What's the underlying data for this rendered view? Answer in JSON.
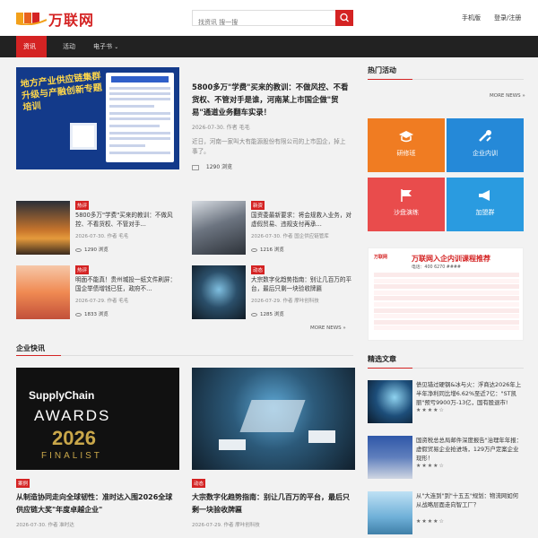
{
  "header": {
    "logo_text": "万联网",
    "search_placeholder": "找资讯 搜一搜",
    "mobile_label": "手机版",
    "login_label": "登录/注册"
  },
  "nav": [
    {
      "label": "资讯",
      "active": true,
      "has_menu": true
    },
    {
      "label": "活动",
      "active": false,
      "has_menu": false
    },
    {
      "label": "电子书",
      "active": false,
      "has_menu": true
    }
  ],
  "featured": {
    "banner_text": "地方产业供应链集群升级与产融创新专题培训",
    "title": "5800多万\"学费\"买来的教训：不做风控、不看货权、不管对手是谁，河南某上市国企做\"贸易\"通道业务翻车实录！",
    "meta": "2026-07-30. 作者 毛毛",
    "desc": "近日，河南一家叫大有能源股份有限公司的上市国企，掉上事了。",
    "views": "1290 浏览"
  },
  "cards": [
    {
      "tag": "热评",
      "title": "5800多万\"学费\"买来的教训：不做风控、不看货权、不管对手...",
      "meta": "2026-07-30. 作者 毛毛",
      "views": "1290 浏览"
    },
    {
      "tag": "新资",
      "title": "国资委最新要求：将会规救入业务，对虚假贸易、违规支付再承...",
      "meta": "2026-07-30. 作者 国企供应链管库",
      "views": "1216 浏览"
    },
    {
      "tag": "热评",
      "title": "明面不能真！贵州城投一纸文件刷屏：国企举债增钱已狂，政府不...",
      "meta": "2026-07-29. 作者 毛毛",
      "views": "1833 浏览"
    },
    {
      "tag": "动态",
      "title": "大宗数字化趋势指南：别让几百万的平台，最后只剩一块验收牌匾",
      "meta": "2026-07-29. 作者 摩咔创科技",
      "views": "1285 浏览"
    }
  ],
  "more_label": "MORE NEWS »",
  "enterprise": {
    "section_title": "企业快讯",
    "items": [
      {
        "tag": "案例",
        "title": "从制造协同走向全球韧性：准时达入围2026全球供应链大奖\"年度卓越企业\"",
        "meta": "2026-07-30. 作者 准时达",
        "award_brand": "SupplyChain",
        "award_word": "AWARDS",
        "award_year": "2026",
        "award_status": "FINALIST"
      },
      {
        "tag": "动态",
        "title": "大宗数字化趋势指南：别让几百万的平台，最后只剩一块验收牌匾",
        "meta": "2026-07-29. 作者 摩咔创科技"
      }
    ]
  },
  "sidebar": {
    "hot_title": "热门活动",
    "more_label": "MORE NEWS »",
    "tiles": [
      {
        "label": "研修班",
        "color": "#f07c22",
        "icon": "graduation-cap-icon"
      },
      {
        "label": "企业内训",
        "color": "#2589d8",
        "icon": "tools-icon"
      },
      {
        "label": "沙盘演练",
        "color": "#e94c4c",
        "icon": "flag-icon"
      },
      {
        "label": "加盟群",
        "color": "#2a9be0",
        "icon": "megaphone-icon"
      }
    ],
    "ad": {
      "brand": "万联网",
      "title": "万联网入企内训课程推荐",
      "phone": "电话：400 6270 ####"
    },
    "picks_title": "精选文章",
    "picks": [
      {
        "title": "债见错过硬钢&冰与火：浮商达2026年上半年净利同比增6.62%至近7亿：\"ST凯丽\"预亏9900万-13亿，国有股退市!",
        "stars": "★★★★☆"
      },
      {
        "title": "国资税总总局邮件深度报告\"治理年年报：虚假贸易企业抢进场，129万户定案企业现形！",
        "stars": "★★★★☆"
      },
      {
        "title": "从\"大连到\"到\"十五五\"规划：物流网如何从战略层面走向智工厂？",
        "stars": "★★★★☆"
      }
    ]
  }
}
